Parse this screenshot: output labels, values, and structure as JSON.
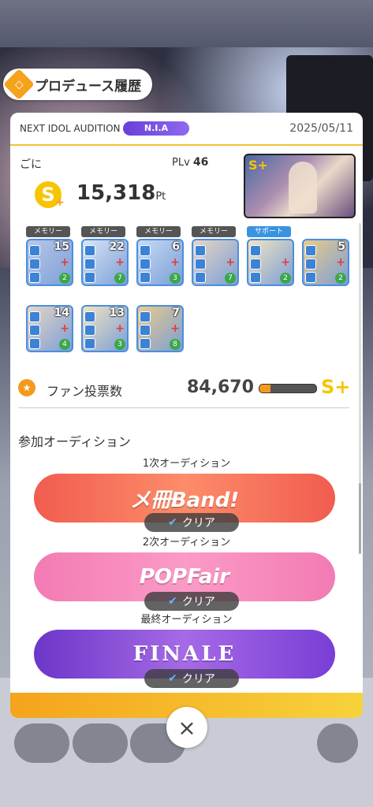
{
  "header": {
    "title": "プロデュース履歴",
    "audition_label": "NEXT IDOL AUDITION",
    "audition_code": "N.I.A",
    "date": "2025/05/11"
  },
  "producer": {
    "name": "ごに",
    "plv_label": "PLv",
    "plv_value": "46",
    "rank": "S+",
    "score": "15,318",
    "score_unit": "Pt"
  },
  "cards_row1": [
    {
      "tag": "メモリー",
      "num": "15",
      "lvl": "2"
    },
    {
      "tag": "メモリー",
      "num": "22",
      "lvl": "7"
    },
    {
      "tag": "メモリー",
      "num": "6",
      "lvl": "3"
    },
    {
      "tag": "メモリー",
      "num": "",
      "lvl": "7"
    },
    {
      "tag": "サポート",
      "num": "",
      "lvl": "2"
    },
    {
      "tag": "",
      "num": "5",
      "lvl": "2"
    }
  ],
  "cards_row2": [
    {
      "num": "14",
      "lvl": "4"
    },
    {
      "num": "13",
      "lvl": "3"
    },
    {
      "num": "7",
      "lvl": "8"
    }
  ],
  "fan_votes": {
    "label": "ファン投票数",
    "value": "84,670",
    "progress": 0.2,
    "rank": "S+"
  },
  "auditions": {
    "title": "参加オーディション",
    "items": [
      {
        "stage": "1次オーディション",
        "logo": "メ冊Band!",
        "status": "クリア"
      },
      {
        "stage": "2次オーディション",
        "logo": "POPFair",
        "status": "クリア"
      },
      {
        "stage": "最終オーディション",
        "logo": "FINALE",
        "status": "クリア"
      }
    ]
  },
  "close_label": "×",
  "colors": {
    "accent": "#f5a31d",
    "nia": "#7b52e3",
    "clear_check": "#64b6ff"
  }
}
